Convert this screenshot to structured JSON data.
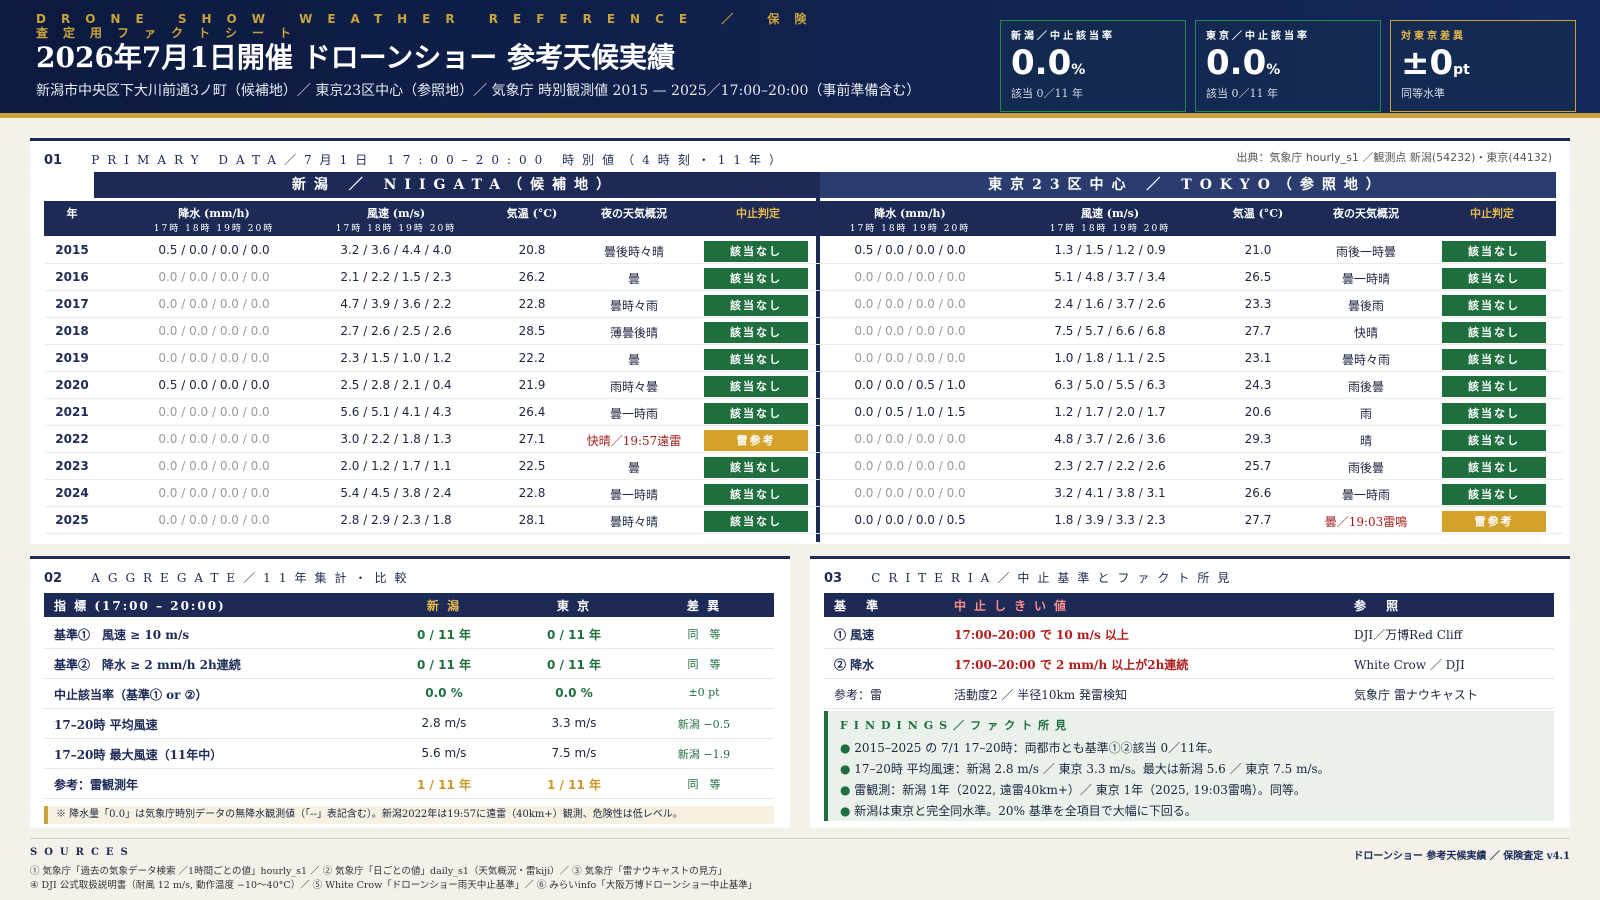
{
  "header": {
    "eyebrow": "DRONE SHOW WEATHER REFERENCE ／ 保険査定用ファクトシート",
    "title": "2026年7月1日開催 ドローンショー 参考天候実績",
    "subtitle": "新潟市中央区下大川前通3ノ町（候補地）／ 東京23区中心（参照地）／ 気象庁 時別観測値 2015 — 2025／17:00–20:00（事前準備含む）"
  },
  "kpis": [
    {
      "label": "新潟／中止該当率",
      "value": "0.0",
      "unit": "%",
      "sub": "該当 0／11 年"
    },
    {
      "label": "東京／中止該当率",
      "value": "0.0",
      "unit": "%",
      "sub": "該当 0／11 年"
    },
    {
      "label": "対東京差異",
      "value": "±0",
      "unit": "pt",
      "sub": "同等水準"
    }
  ],
  "section1": {
    "num": "01",
    "title": "PRIMARY DATA／7月1日 17:00–20:00 時別値（4時刻・11年）",
    "source": "出典：気象庁 hourly_s1 ／観測点 新潟(54232)・東京(44132)",
    "region_niigata": "新潟 ／ NIIGATA（候補地）",
    "region_tokyo": "東京23区中心 ／ TOKYO（参照地）",
    "headers": {
      "year": "年",
      "precip": "降水 (mm/h)",
      "wind": "風速 (m/s)",
      "hours": "17時 18時 19時 20時",
      "temp": "気温 (°C)",
      "weather": "夜の天気概況",
      "judge": "中止判定"
    },
    "rows": [
      {
        "year": "2015",
        "n_precip": "0.5 / 0.0 / 0.0 / 0.0",
        "n_wind": "3.2 / 3.6 / 4.4 / 4.0",
        "n_temp": "20.8",
        "n_wx": "曇後時々晴",
        "n_judge": "該当なし",
        "t_precip": "0.5 / 0.0 / 0.0 / 0.0",
        "t_wind": "1.3 / 1.5 / 1.2 / 0.9",
        "t_temp": "21.0",
        "t_wx": "雨後一時曇",
        "t_judge": "該当なし"
      },
      {
        "year": "2016",
        "n_precip": "0.0 / 0.0 / 0.0 / 0.0",
        "n_wind": "2.1 / 2.2 / 1.5 / 2.3",
        "n_temp": "26.2",
        "n_wx": "曇",
        "n_judge": "該当なし",
        "t_precip": "0.0 / 0.0 / 0.0 / 0.0",
        "t_wind": "5.1 / 4.8 / 3.7 / 3.4",
        "t_temp": "26.5",
        "t_wx": "曇一時晴",
        "t_judge": "該当なし"
      },
      {
        "year": "2017",
        "n_precip": "0.0 / 0.0 / 0.0 / 0.0",
        "n_wind": "4.7 / 3.9 / 3.6 / 2.2",
        "n_temp": "22.8",
        "n_wx": "曇時々雨",
        "n_judge": "該当なし",
        "t_precip": "0.0 / 0.0 / 0.0 / 0.0",
        "t_wind": "2.4 / 1.6 / 3.7 / 2.6",
        "t_temp": "23.3",
        "t_wx": "曇後雨",
        "t_judge": "該当なし"
      },
      {
        "year": "2018",
        "n_precip": "0.0 / 0.0 / 0.0 / 0.0",
        "n_wind": "2.7 / 2.6 / 2.5 / 2.6",
        "n_temp": "28.5",
        "n_wx": "薄曇後晴",
        "n_judge": "該当なし",
        "t_precip": "0.0 / 0.0 / 0.0 / 0.0",
        "t_wind": "7.5 / 5.7 / 6.6 / 6.8",
        "t_temp": "27.7",
        "t_wx": "快晴",
        "t_judge": "該当なし"
      },
      {
        "year": "2019",
        "n_precip": "0.0 / 0.0 / 0.0 / 0.0",
        "n_wind": "2.3 / 1.5 / 1.0 / 1.2",
        "n_temp": "22.2",
        "n_wx": "曇",
        "n_judge": "該当なし",
        "t_precip": "0.0 / 0.0 / 0.0 / 0.0",
        "t_wind": "1.0 / 1.8 / 1.1 / 2.5",
        "t_temp": "23.1",
        "t_wx": "曇時々雨",
        "t_judge": "該当なし"
      },
      {
        "year": "2020",
        "n_precip": "0.5 / 0.0 / 0.0 / 0.0",
        "n_wind": "2.5 / 2.8 / 2.1 / 0.4",
        "n_temp": "21.9",
        "n_wx": "雨時々曇",
        "n_judge": "該当なし",
        "t_precip": "0.0 / 0.0 / 0.5 / 1.0",
        "t_wind": "6.3 / 5.0 / 5.5 / 6.3",
        "t_temp": "24.3",
        "t_wx": "雨後曇",
        "t_judge": "該当なし"
      },
      {
        "year": "2021",
        "n_precip": "0.0 / 0.0 / 0.0 / 0.0",
        "n_wind": "5.6 / 5.1 / 4.1 / 4.3",
        "n_temp": "26.4",
        "n_wx": "曇一時雨",
        "n_judge": "該当なし",
        "t_precip": "0.0 / 0.5 / 1.0 / 1.5",
        "t_wind": "1.2 / 1.7 / 2.0 / 1.7",
        "t_temp": "20.6",
        "t_wx": "雨",
        "t_judge": "該当なし"
      },
      {
        "year": "2022",
        "n_precip": "0.0 / 0.0 / 0.0 / 0.0",
        "n_wind": "3.0 / 2.2 / 1.8 / 1.3",
        "n_temp": "27.1",
        "n_wx": "快晴／19:57遠雷",
        "n_judge": "雷参考",
        "t_precip": "0.0 / 0.0 / 0.0 / 0.0",
        "t_wind": "4.8 / 3.7 / 2.6 / 3.6",
        "t_temp": "29.3",
        "t_wx": "晴",
        "t_judge": "該当なし"
      },
      {
        "year": "2023",
        "n_precip": "0.0 / 0.0 / 0.0 / 0.0",
        "n_wind": "2.0 / 1.2 / 1.7 / 1.1",
        "n_temp": "22.5",
        "n_wx": "曇",
        "n_judge": "該当なし",
        "t_precip": "0.0 / 0.0 / 0.0 / 0.0",
        "t_wind": "2.3 / 2.7 / 2.2 / 2.6",
        "t_temp": "25.7",
        "t_wx": "雨後曇",
        "t_judge": "該当なし"
      },
      {
        "year": "2024",
        "n_precip": "0.0 / 0.0 / 0.0 / 0.0",
        "n_wind": "5.4 / 4.5 / 3.8 / 2.4",
        "n_temp": "22.8",
        "n_wx": "曇一時晴",
        "n_judge": "該当なし",
        "t_precip": "0.0 / 0.0 / 0.0 / 0.0",
        "t_wind": "3.2 / 4.1 / 3.8 / 3.1",
        "t_temp": "26.6",
        "t_wx": "曇一時雨",
        "t_judge": "該当なし"
      },
      {
        "year": "2025",
        "n_precip": "0.0 / 0.0 / 0.0 / 0.0",
        "n_wind": "2.8 / 2.9 / 2.3 / 1.8",
        "n_temp": "28.1",
        "n_wx": "曇時々晴",
        "n_judge": "該当なし",
        "t_precip": "0.0 / 0.0 / 0.0 / 0.5",
        "t_wind": "1.8 / 3.9 / 3.3 / 2.3",
        "t_temp": "27.7",
        "t_wx": "曇／19:03雷鳴",
        "t_judge": "雷参考"
      }
    ]
  },
  "section2": {
    "num": "02",
    "title": "AGGREGATE／11年集計・比較",
    "headers": {
      "metric": "指 標 (17:00 – 20:00)",
      "niigata": "新 潟",
      "tokyo": "東 京",
      "diff": "差 異"
    },
    "rows": [
      {
        "label": "基準①　風速 ≥ 10 m/s",
        "niigata": "0 / 11 年",
        "tokyo": "0 / 11 年",
        "diff": "同　等",
        "style": "green"
      },
      {
        "label": "基準②　降水 ≥ 2 mm/h 2h連続",
        "niigata": "0 / 11 年",
        "tokyo": "0 / 11 年",
        "diff": "同　等",
        "style": "green"
      },
      {
        "label": "中止該当率（基準① or ②）",
        "niigata": "0.0 %",
        "tokyo": "0.0 %",
        "diff": "±0 pt",
        "style": "green"
      },
      {
        "label": "17–20時 平均風速",
        "niigata": "2.8 m/s",
        "tokyo": "3.3 m/s",
        "diff": "新潟 −0.5",
        "style": "plain"
      },
      {
        "label": "17–20時 最大風速（11年中）",
        "niigata": "5.6 m/s",
        "tokyo": "7.5 m/s",
        "diff": "新潟 −1.9",
        "style": "plain"
      },
      {
        "label": "参考：雷観測年",
        "niigata": "1 / 11 年",
        "tokyo": "1 / 11 年",
        "diff": "同　等",
        "style": "gold"
      }
    ],
    "note": "※ 降水量「0.0」は気象庁時別データの無降水観測値（「--」表記含む）。新潟2022年は19:57に遠雷（40km+）観測、危険性は低レベル。"
  },
  "section3": {
    "num": "03",
    "title": "CRITERIA／中止基準とファクト所見",
    "headers": {
      "criteria": "基 準",
      "threshold": "中止しきい値",
      "ref": "参 照"
    },
    "rows": [
      {
        "criteria": "① 風速",
        "threshold": "17:00–20:00 で 10 m/s 以上",
        "ref": "DJI／万博Red Cliff",
        "red": true
      },
      {
        "criteria": "② 降水",
        "threshold": "17:00–20:00 で 2 mm/h 以上が2h連続",
        "ref": "White Crow ／ DJI",
        "red": true
      },
      {
        "criteria": "参考：雷",
        "threshold": "活動度2 ／ 半径10km 発雷検知",
        "ref": "気象庁 雷ナウキャスト",
        "red": false
      }
    ],
    "findings_title": "FINDINGS／ファクト所見",
    "findings": [
      "2015–2025 の 7/1 17–20時：両都市とも基準①②該当 0／11年。",
      "17–20時 平均風速：新潟 2.8 m/s ／ 東京 3.3 m/s。最大は新潟 5.6 ／ 東京 7.5 m/s。",
      "雷観測：新潟 1年（2022, 遠雷40km+）／ 東京 1年（2025, 19:03雷鳴）。同等。",
      "新潟は東京と完全同水準。20% 基準を全項目で大幅に下回る。"
    ]
  },
  "footer": {
    "sources_title": "SOURCES",
    "line1": "① 気象庁「過去の気象データ検索 ／1時間ごとの値」hourly_s1 ／ ② 気象庁「日ごとの値」daily_s1（天気概況・雷kiji）／ ③ 気象庁「雷ナウキャストの見方」",
    "line2": "④ DJI 公式取扱説明書（耐風 12 m/s, 動作温度 −10〜40°C）／ ⑤ White Crow「ドローンショー雨天中止基準」／ ⑥ みらいinfo「大阪万博ドローンショー中止基準」",
    "tag": "ドローンショー 参考天候実績 ／ 保険査定 v4.1"
  }
}
